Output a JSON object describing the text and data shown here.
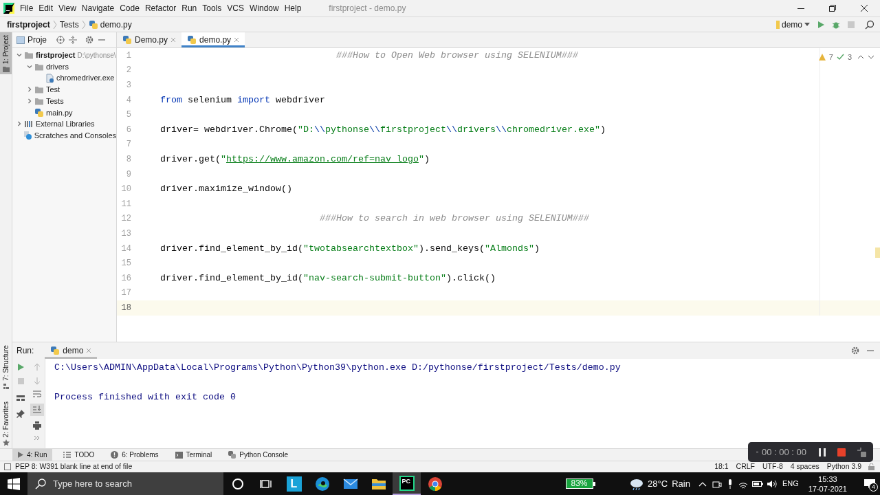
{
  "title_bar": {
    "menus": [
      "File",
      "Edit",
      "View",
      "Navigate",
      "Code",
      "Refactor",
      "Run",
      "Tools",
      "VCS",
      "Window",
      "Help"
    ],
    "title": "firstproject - demo.py"
  },
  "breadcrumb": [
    {
      "label": "firstproject",
      "kind": "project"
    },
    {
      "label": "Tests",
      "kind": "folder"
    },
    {
      "label": "demo.py",
      "kind": "python"
    }
  ],
  "run_config": "demo",
  "project_panel": {
    "stripe_button": {
      "label": "1: Project",
      "selected": true
    },
    "title": "Proje",
    "tree": [
      {
        "label": "firstproject",
        "path": "D:\\pythonse\\",
        "kind": "project",
        "expanded": true,
        "children": [
          {
            "label": "drivers",
            "kind": "folder",
            "expanded": true,
            "children": [
              {
                "label": "chromedriver.exe",
                "kind": "unknown_file"
              }
            ]
          },
          {
            "label": "Test",
            "kind": "folder",
            "expanded": false
          },
          {
            "label": "Tests",
            "kind": "folder",
            "expanded": false
          },
          {
            "label": "main.py",
            "kind": "python"
          }
        ]
      },
      {
        "label": "External Libraries",
        "kind": "libraries",
        "expanded": false
      },
      {
        "label": "Scratches and Consoles",
        "kind": "scratches"
      }
    ]
  },
  "editor_tabs": [
    {
      "label": "Demo.py",
      "selected": false
    },
    {
      "label": "demo.py",
      "selected": true
    }
  ],
  "inspections": {
    "warnings": "7",
    "typos": "3"
  },
  "code_lines": [
    {
      "number": "1",
      "current": false,
      "tokens": [
        {
          "kind": "comment",
          "text": "                                ###How to Open Web browser using SELENIUM###"
        }
      ]
    },
    {
      "number": "2",
      "current": false
    },
    {
      "number": "3",
      "current": false
    },
    {
      "number": "4",
      "current": false,
      "tokens": [
        {
          "kind": "kw",
          "text": "from"
        },
        {
          "kind": "plain",
          "text": " selenium "
        },
        {
          "kind": "kw",
          "text": "import"
        },
        {
          "kind": "plain",
          "text": " webdriver"
        }
      ]
    },
    {
      "number": "5",
      "current": false
    },
    {
      "number": "6",
      "current": false,
      "tokens": [
        {
          "kind": "plain",
          "text": "driver= webdriver.Chrome("
        },
        {
          "kind": "str",
          "text": "\"D:"
        },
        {
          "kind": "esc",
          "text": "\\\\"
        },
        {
          "kind": "str",
          "text": "pythonse"
        },
        {
          "kind": "esc",
          "text": "\\\\"
        },
        {
          "kind": "str",
          "text": "firstproject"
        },
        {
          "kind": "esc",
          "text": "\\\\"
        },
        {
          "kind": "str",
          "text": "drivers"
        },
        {
          "kind": "esc",
          "text": "\\\\"
        },
        {
          "kind": "str",
          "text": "chromedriver.exe\""
        },
        {
          "kind": "plain",
          "text": ")"
        }
      ]
    },
    {
      "number": "7",
      "current": false
    },
    {
      "number": "8",
      "current": false,
      "tokens": [
        {
          "kind": "plain",
          "text": "driver.get("
        },
        {
          "kind": "str",
          "text": "\""
        },
        {
          "kind": "url",
          "text": "https://www.amazon.com/ref=nav_logo"
        },
        {
          "kind": "str",
          "text": "\""
        },
        {
          "kind": "plain",
          "text": ")"
        }
      ]
    },
    {
      "number": "9",
      "current": false
    },
    {
      "number": "10",
      "current": false,
      "tokens": [
        {
          "kind": "plain",
          "text": "driver.maximize_window()"
        }
      ]
    },
    {
      "number": "11",
      "current": false
    },
    {
      "number": "12",
      "current": false,
      "tokens": [
        {
          "kind": "comment",
          "text": "                             ###How to search in web browser using SELENIUM###"
        }
      ]
    },
    {
      "number": "13",
      "current": false
    },
    {
      "number": "14",
      "current": false,
      "tokens": [
        {
          "kind": "plain",
          "text": "driver.find_element_by_id("
        },
        {
          "kind": "str",
          "text": "\"twotabsearchtextbox\""
        },
        {
          "kind": "plain",
          "text": ").send_keys("
        },
        {
          "kind": "str",
          "text": "\"Almonds\""
        },
        {
          "kind": "plain",
          "text": ")"
        }
      ]
    },
    {
      "number": "15",
      "current": false
    },
    {
      "number": "16",
      "current": false,
      "tokens": [
        {
          "kind": "plain",
          "text": "driver.find_element_by_id("
        },
        {
          "kind": "str",
          "text": "\"nav-search-submit-button\""
        },
        {
          "kind": "plain",
          "text": ").click()"
        }
      ]
    },
    {
      "number": "17",
      "current": false
    },
    {
      "number": "18",
      "current": true
    }
  ],
  "run_panel": {
    "label": "Run:",
    "stripe_buttons": [
      {
        "label": "7: Structure",
        "selected": false,
        "kind": "structure"
      },
      {
        "label": "2: Favorites",
        "selected": false,
        "kind": "favorites"
      }
    ],
    "tabs": [
      {
        "label": "demo",
        "selected": true
      }
    ],
    "console": [
      {
        "kind": "command",
        "text": "C:\\Users\\ADMIN\\AppData\\Local\\Programs\\Python\\Python39\\python.exe D:/pythonse/firstproject/Tests/demo.py"
      },
      {
        "kind": "exit",
        "text": "Process finished with exit code 0"
      }
    ]
  },
  "tool_tabs": [
    {
      "label": "4: Run",
      "kind": "run",
      "selected": true
    },
    {
      "label": "TODO",
      "kind": "todo",
      "selected": false
    },
    {
      "label": "6: Problems",
      "kind": "problems",
      "selected": false
    },
    {
      "label": "Terminal",
      "kind": "terminal",
      "selected": false
    },
    {
      "label": "Python Console",
      "kind": "python_console",
      "selected": false
    }
  ],
  "status_bar": {
    "message": "PEP 8: W391 blank line at end of file",
    "items": [
      "18:1",
      "CRLF",
      "UTF-8",
      "4 spaces",
      "Python 3.9"
    ]
  },
  "recorder": {
    "time": "00 : 00 : 00"
  },
  "taskbar": {
    "search_placeholder": "Type here to search",
    "apps": [
      {
        "kind": "cortana",
        "selected": false
      },
      {
        "kind": "task_view",
        "selected": false
      },
      {
        "kind": "letter_app",
        "glyph": "L",
        "selected": false
      },
      {
        "kind": "edge",
        "selected": false
      },
      {
        "kind": "mail",
        "selected": false
      },
      {
        "kind": "explorer",
        "selected": false
      },
      {
        "kind": "pycharm",
        "glyph": "PC",
        "selected": true
      },
      {
        "kind": "chrome",
        "selected": false
      }
    ],
    "battery": "83%",
    "weather": {
      "temp": "28°C",
      "text": "Rain"
    },
    "language": "ENG",
    "time": "15:33",
    "date": "17-07-2021",
    "notifications": "4"
  }
}
